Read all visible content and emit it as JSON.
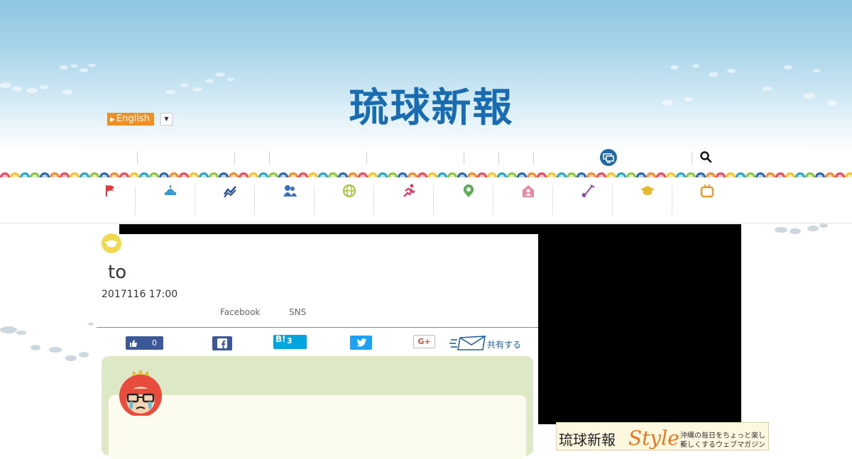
{
  "site": {
    "logo": "琉球新報"
  },
  "language": {
    "button_label": "English",
    "dropdown_icon": "caret-down-icon"
  },
  "top_nav": {
    "dividers": 8,
    "icons": [
      "desktop-icon",
      "search-icon"
    ]
  },
  "category_nav": {
    "icons": [
      "flag-icon",
      "government-icon",
      "economy-chart-icon",
      "people-icon",
      "world-globe-icon",
      "sports-icon",
      "location-pin-icon",
      "life-house-icon",
      "culture-sanshin-icon",
      "education-cap-icon",
      "entertainment-tv-icon"
    ],
    "colors": [
      "#e03a3a",
      "#3b9bd1",
      "#2b4f95",
      "#3b72c0",
      "#a2c037",
      "#d8406c",
      "#5fad56",
      "#e68aa2",
      "#8e4e9e",
      "#e9b82a",
      "#ea9a2a"
    ]
  },
  "article": {
    "category_badge_icon": "graduation-cap-icon",
    "headline": "to",
    "date": "2017116 17:00",
    "share_labels": {
      "facebook": "Facebook",
      "sns": "SNS"
    }
  },
  "share_buttons": {
    "like_count": "0",
    "hatena_label": "B!",
    "hatena_count": "3",
    "google_plus_label": "G+",
    "share_label": "共有する"
  },
  "comment": {
    "avatar": "crying-king-mascot"
  },
  "banner": {
    "brand": "琉球新報",
    "word": "Style",
    "tagline_1": "沖縄の毎日をちょっと楽しく",
    "tagline_2": "新しくするウェブマガジン"
  },
  "colors": {
    "logo_blue": "#1a6cb0",
    "accent_orange": "#ee8f22",
    "facebook": "#3b5998",
    "hatena": "#00a4de",
    "twitter": "#1da1f2",
    "comment_bg": "#dde9c6"
  }
}
